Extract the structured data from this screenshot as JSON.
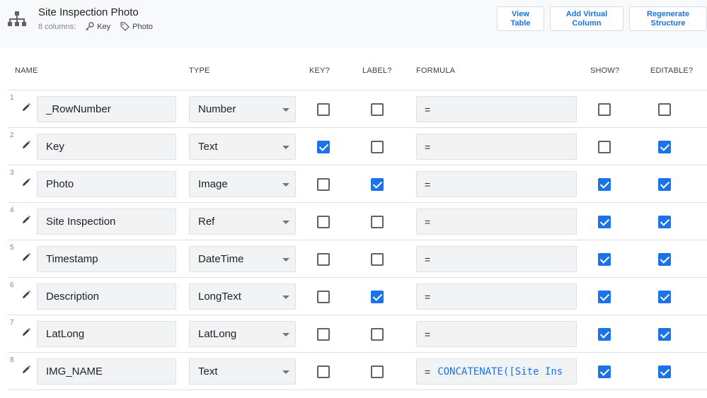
{
  "header": {
    "title": "Site Inspection Photo",
    "columns_count": "8 columns:",
    "key_tag": "Key",
    "label_tag": "Photo",
    "buttons": {
      "view_table": "View\nTable",
      "add_virtual_column": "Add Virtual\nColumn",
      "regenerate_structure": "Regenerate\nStructure"
    }
  },
  "columns": {
    "name": "NAME",
    "type": "TYPE",
    "key": "KEY?",
    "label": "LABEL?",
    "formula": "FORMULA",
    "show": "SHOW?",
    "editable": "EDITABLE?"
  },
  "rows": [
    {
      "num": "1",
      "name": "_RowNumber",
      "type": "Number",
      "key": false,
      "label": false,
      "formula_eq": "=",
      "formula": "",
      "show": false,
      "editable": false
    },
    {
      "num": "2",
      "name": "Key",
      "type": "Text",
      "key": true,
      "label": false,
      "formula_eq": "=",
      "formula": "",
      "show": false,
      "editable": true
    },
    {
      "num": "3",
      "name": "Photo",
      "type": "Image",
      "key": false,
      "label": true,
      "formula_eq": "=",
      "formula": "",
      "show": true,
      "editable": true
    },
    {
      "num": "4",
      "name": "Site Inspection",
      "type": "Ref",
      "key": false,
      "label": false,
      "formula_eq": "=",
      "formula": "",
      "show": true,
      "editable": true
    },
    {
      "num": "5",
      "name": "Timestamp",
      "type": "DateTime",
      "key": false,
      "label": false,
      "formula_eq": "=",
      "formula": "",
      "show": true,
      "editable": true
    },
    {
      "num": "6",
      "name": "Description",
      "type": "LongText",
      "key": false,
      "label": true,
      "formula_eq": "=",
      "formula": "",
      "show": true,
      "editable": true
    },
    {
      "num": "7",
      "name": "LatLong",
      "type": "LatLong",
      "key": false,
      "label": false,
      "formula_eq": "=",
      "formula": "",
      "show": true,
      "editable": true
    },
    {
      "num": "8",
      "name": "IMG_NAME",
      "type": "Text",
      "key": false,
      "label": false,
      "formula_eq": "=",
      "formula": "CONCATENATE([Site Ins",
      "show": true,
      "editable": true
    }
  ],
  "icons": {
    "table_structure": "sitemap-icon",
    "key": "key-icon",
    "label": "tag-icon",
    "edit": "pencil-icon",
    "dropdown": "caret-down-icon"
  },
  "colors": {
    "accent": "#1a73e8",
    "header_bg": "#f8f9fa",
    "field_bg": "#f1f3f4"
  }
}
